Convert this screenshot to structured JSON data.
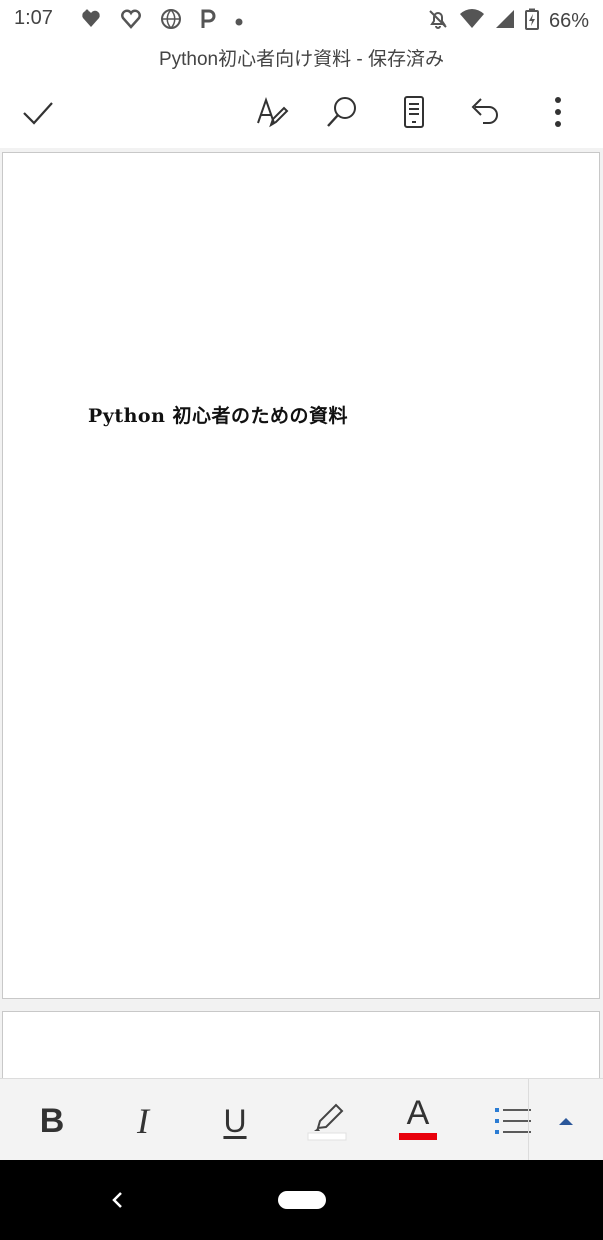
{
  "status_bar": {
    "time": "1:07",
    "battery": "66%"
  },
  "title": "Python初心者向け資料 - 保存済み",
  "document": {
    "page1_text": "Python 初心者のための資料"
  },
  "format_bar": {
    "bold": "B",
    "italic": "I",
    "underline": "U",
    "font_color_letter": "A"
  },
  "colors": {
    "font_color": "#e8000b",
    "highlight_color": "#ffffff",
    "accent": "#2b579a"
  }
}
